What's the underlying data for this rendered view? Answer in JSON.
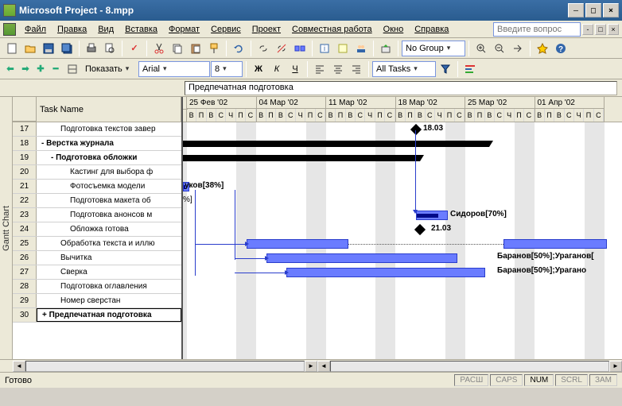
{
  "window": {
    "title": "Microsoft Project - 8.mpp"
  },
  "menu": {
    "file": "Файл",
    "edit": "Правка",
    "view": "Вид",
    "insert": "Вставка",
    "format": "Формат",
    "tools": "Сервис",
    "project": "Проект",
    "collab": "Совместная работа",
    "window": "Окно",
    "help": "Справка",
    "ask_placeholder": "Введите вопрос"
  },
  "toolbar2": {
    "show_label": "Показать",
    "font": "Arial",
    "size": "8",
    "group": "No Group",
    "filter": "All Tasks"
  },
  "entry_bar": {
    "value": "Предпечатная подготовка"
  },
  "side": {
    "label": "Gantt Chart"
  },
  "grid": {
    "header": "Task Name",
    "rows": [
      {
        "n": "17",
        "t": "Подготовка текстов завер",
        "i": 2
      },
      {
        "n": "18",
        "t": "- Верстка журнала",
        "i": 0,
        "b": true
      },
      {
        "n": "19",
        "t": "- Подготовка обложки",
        "i": 1,
        "b": true
      },
      {
        "n": "20",
        "t": "Кастинг для выбора ф",
        "i": 3
      },
      {
        "n": "21",
        "t": "Фотосъемка модели",
        "i": 3
      },
      {
        "n": "22",
        "t": "Подготовка макета об",
        "i": 3
      },
      {
        "n": "23",
        "t": "Подготовка анонсов м",
        "i": 3
      },
      {
        "n": "24",
        "t": "Обложка готова",
        "i": 3
      },
      {
        "n": "25",
        "t": "Обработка текста и иллю",
        "i": 2
      },
      {
        "n": "26",
        "t": "Вычитка",
        "i": 2
      },
      {
        "n": "27",
        "t": "Сверка",
        "i": 2
      },
      {
        "n": "28",
        "t": "Подготовка оглавления",
        "i": 2
      },
      {
        "n": "29",
        "t": "Номер сверстан",
        "i": 2
      },
      {
        "n": "30",
        "t": "+ Предпечатная подготовка",
        "i": 0,
        "b": true,
        "sel": true
      }
    ]
  },
  "timeline": {
    "weeks": [
      "25 Фев '02",
      "04 Мар '02",
      "11 Мар '02",
      "18 Мар '02",
      "25 Мар '02",
      "01 Апр '02"
    ],
    "days": [
      "В",
      "П",
      "В",
      "С",
      "Ч",
      "П",
      "С"
    ]
  },
  "labels": {
    "m1": "18.03",
    "m2": "21.03",
    "l1": "уков[38%]",
    "l2": "Сидоров[70%]",
    "l3": "Баранов[50%];Ураганов[",
    "l4": "Баранов[50%];Урагано"
  },
  "status": {
    "ready": "Готово",
    "ext": "РАСШ",
    "caps": "CAPS",
    "num": "NUM",
    "scrl": "SCRL",
    "ovr": "ЗАМ"
  }
}
